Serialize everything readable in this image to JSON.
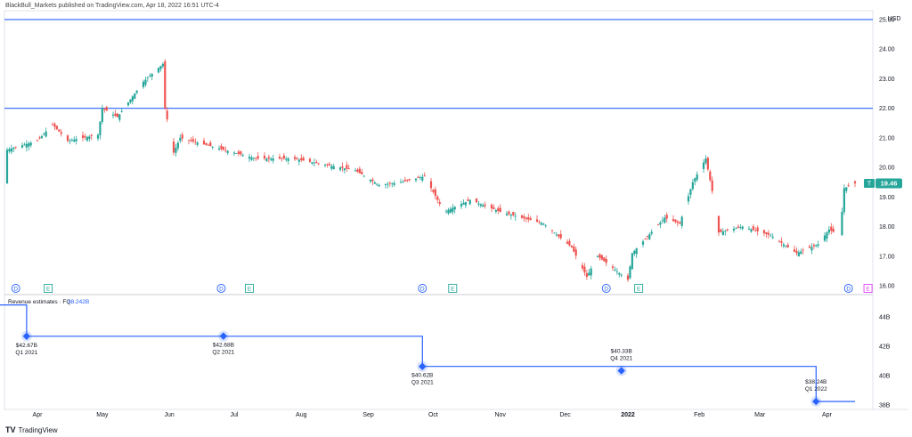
{
  "header": "BlackBull_Markets published on TradingView.com, Apr 18, 2022 16:51 UTC-4",
  "footer": {
    "brand": "TradingView",
    "logo_text": "TV"
  },
  "colors": {
    "up": "#26a69a",
    "down": "#ef5350",
    "level": "#2962ff",
    "revenue": "#2962ff",
    "last_price_bg": "#26a69a"
  },
  "chart_data": [
    {
      "type": "candlestick",
      "currency_label": "USD",
      "ylim": [
        15.7,
        25.3
      ],
      "y_ticks": [
        "16.00",
        "17.00",
        "18.00",
        "19.00",
        "20.00",
        "21.00",
        "22.00",
        "23.00",
        "24.00",
        "25.00"
      ],
      "last_price": "19.46",
      "last_price_marker": "T",
      "horizontal_levels": [
        25.0,
        22.0
      ],
      "x_labels": [
        "Apr",
        "May",
        "Jun",
        "Jul",
        "Aug",
        "Sep",
        "Oct",
        "Nov",
        "Dec",
        "2022",
        "Feb",
        "Mar",
        "Apr"
      ],
      "price_path": [
        [
          "2021-03-22",
          20.6
        ],
        [
          "2021-04-05",
          20.9
        ],
        [
          "2021-04-12",
          21.45
        ],
        [
          "2021-04-19",
          20.9
        ],
        [
          "2021-05-03",
          21.1
        ],
        [
          "2021-05-05",
          22.0
        ],
        [
          "2021-05-12",
          21.7
        ],
        [
          "2021-05-24",
          22.9
        ],
        [
          "2021-06-02",
          23.5
        ],
        [
          "2021-06-03",
          22.0
        ],
        [
          "2021-06-07",
          20.5
        ],
        [
          "2021-06-10",
          21.0
        ],
        [
          "2021-07-15",
          20.3
        ],
        [
          "2021-08-01",
          20.3
        ],
        [
          "2021-08-30",
          19.9
        ],
        [
          "2021-09-10",
          19.4
        ],
        [
          "2021-09-20",
          19.5
        ],
        [
          "2021-10-01",
          19.7
        ],
        [
          "2021-10-10",
          18.5
        ],
        [
          "2021-10-22",
          18.9
        ],
        [
          "2021-11-05",
          18.5
        ],
        [
          "2021-11-25",
          18.1
        ],
        [
          "2021-12-08",
          17.3
        ],
        [
          "2021-12-15",
          16.3
        ],
        [
          "2021-12-20",
          17.0
        ],
        [
          "2022-01-03",
          16.2
        ],
        [
          "2022-01-05",
          17.1
        ],
        [
          "2022-01-20",
          18.3
        ],
        [
          "2022-01-27",
          18.1
        ],
        [
          "2022-02-02",
          19.5
        ],
        [
          "2022-02-08",
          20.3
        ],
        [
          "2022-02-11",
          19.2
        ],
        [
          "2022-02-14",
          17.8
        ],
        [
          "2022-02-25",
          18.0
        ],
        [
          "2022-03-10",
          17.7
        ],
        [
          "2022-03-22",
          17.1
        ],
        [
          "2022-04-01",
          17.4
        ],
        [
          "2022-04-06",
          17.9
        ],
        [
          "2022-04-11",
          17.7
        ],
        [
          "2022-04-13",
          19.3
        ],
        [
          "2022-04-18",
          19.46
        ]
      ],
      "event_markers": [
        {
          "label": "D",
          "date": "2021-03-26"
        },
        {
          "label": "E",
          "date": "2021-04-10"
        },
        {
          "label": "D",
          "date": "2021-06-29"
        },
        {
          "label": "E",
          "date": "2021-07-12"
        },
        {
          "label": "D",
          "date": "2021-09-30"
        },
        {
          "label": "E",
          "date": "2021-10-14"
        },
        {
          "label": "D",
          "date": "2021-12-24"
        },
        {
          "label": "E",
          "date": "2022-01-08"
        },
        {
          "label": "D",
          "date": "2022-04-15"
        },
        {
          "label": "E",
          "date": "2022-04-24"
        }
      ]
    },
    {
      "type": "step",
      "title": "Revenue estimates · FQ",
      "current_value": "38.242B",
      "ylim": [
        37.7,
        45.5
      ],
      "y_ticks": [
        "38B",
        "40B",
        "42B",
        "44B"
      ],
      "points": [
        {
          "date": "2021-03-31",
          "value": 42.67,
          "label": "$42.67B",
          "period": "Q1 2021"
        },
        {
          "date": "2021-06-30",
          "value": 42.68,
          "label": "$42.68B",
          "period": "Q2 2021"
        },
        {
          "date": "2021-09-30",
          "value": 40.62,
          "label": "$40.62B",
          "period": "Q3 2021"
        },
        {
          "date": "2021-12-31",
          "value": 40.33,
          "label": "$40.33B",
          "period": "Q4 2021"
        },
        {
          "date": "2022-03-31",
          "value": 38.24,
          "label": "$38.24B",
          "period": "Q1 2022"
        }
      ],
      "steps": [
        [
          "2021-02-20",
          44.8
        ],
        [
          "2021-03-31",
          44.8
        ],
        [
          "2021-03-31",
          42.67
        ],
        [
          "2021-09-30",
          42.67
        ],
        [
          "2021-09-30",
          40.62
        ],
        [
          "2022-03-31",
          40.62
        ],
        [
          "2022-03-31",
          40.33
        ],
        [
          "2022-03-31",
          38.24
        ],
        [
          "2022-04-18",
          38.24
        ]
      ]
    }
  ]
}
